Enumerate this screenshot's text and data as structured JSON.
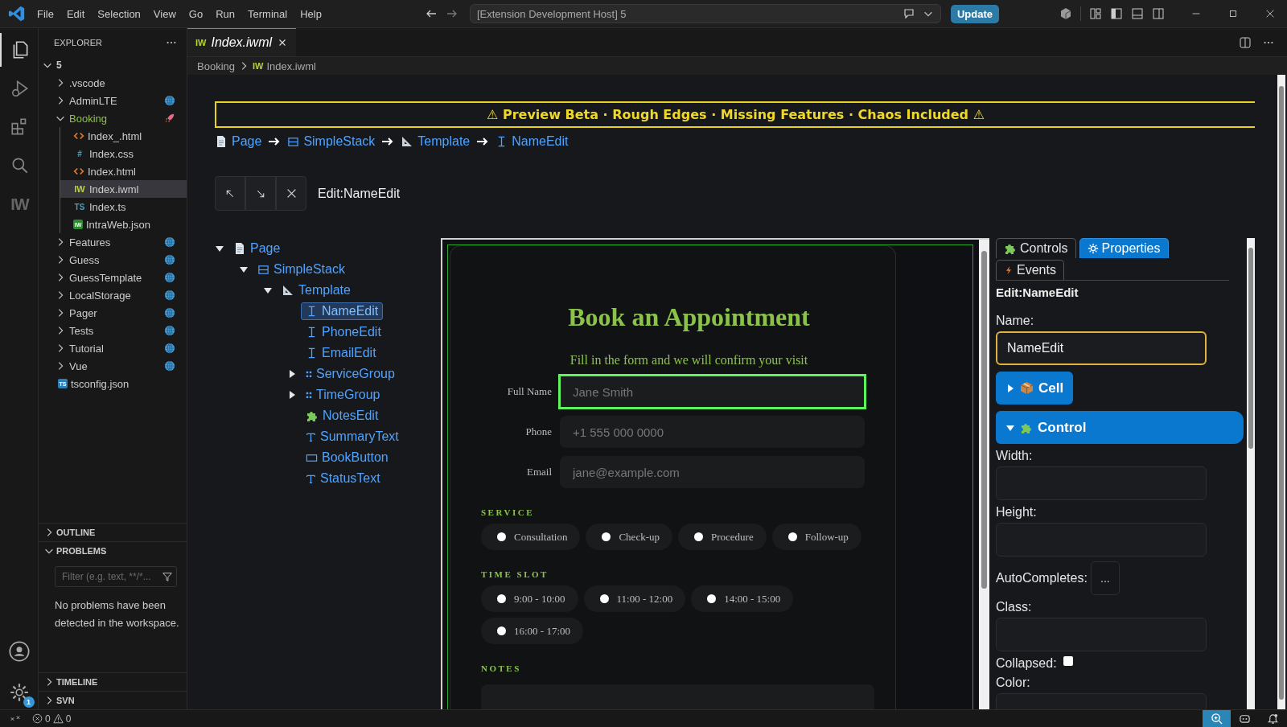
{
  "menu": [
    "File",
    "Edit",
    "Selection",
    "View",
    "Go",
    "Run",
    "Terminal",
    "Help"
  ],
  "command_center": "[Extension Development Host] 5",
  "update_button": "Update",
  "activity_bar": [
    {
      "kind": "files",
      "selected": true
    },
    {
      "kind": "run",
      "selected": false
    },
    {
      "kind": "extensions",
      "selected": false
    },
    {
      "kind": "search",
      "selected": false
    },
    {
      "kind": "iw",
      "label": "IW",
      "selected": false
    }
  ],
  "settings_badge": "1",
  "explorer": {
    "title": "EXPLORER",
    "root": "5",
    "items": [
      {
        "label": ".vscode",
        "kind": "folder",
        "expanded": false
      },
      {
        "label": "AdminLTE",
        "kind": "folder",
        "expanded": false,
        "decoration": {
          "kind": "globe"
        }
      },
      {
        "label": "Booking",
        "kind": "folder",
        "expanded": true,
        "decoration": {
          "kind": "rocket"
        },
        "color": "#8dc149",
        "children": [
          {
            "label": "Index_.html",
            "kind": "html",
            "selected": false
          },
          {
            "label": "Index.css",
            "kind": "css",
            "icon": "#",
            "selected": false
          },
          {
            "label": "Index.html",
            "kind": "html",
            "selected": false
          },
          {
            "label": "Index.iwml",
            "kind": "iwml",
            "icon": "IW",
            "selected": true
          },
          {
            "label": "Index.ts",
            "kind": "ts",
            "icon": "TS",
            "selected": false
          },
          {
            "label": "IntraWeb.json",
            "kind": "json",
            "icon": "IW",
            "selected": false
          }
        ]
      },
      {
        "label": "Features",
        "kind": "folder",
        "expanded": false,
        "decoration": {
          "kind": "globe"
        }
      },
      {
        "label": "Guess",
        "kind": "folder",
        "expanded": false,
        "decoration": {
          "kind": "globe"
        }
      },
      {
        "label": "GuessTemplate",
        "kind": "folder",
        "expanded": false,
        "decoration": {
          "kind": "globe"
        }
      },
      {
        "label": "LocalStorage",
        "kind": "folder",
        "expanded": false,
        "decoration": {
          "kind": "globe"
        }
      },
      {
        "label": "Pager",
        "kind": "folder",
        "expanded": false,
        "decoration": {
          "kind": "globe"
        }
      },
      {
        "label": "Tests",
        "kind": "folder",
        "expanded": false,
        "decoration": {
          "kind": "globe"
        }
      },
      {
        "label": "Tutorial",
        "kind": "folder",
        "expanded": false,
        "decoration": {
          "kind": "globe"
        }
      },
      {
        "label": "Vue",
        "kind": "folder",
        "expanded": false,
        "decoration": {
          "kind": "globe"
        }
      },
      {
        "label": "tsconfig.json",
        "kind": "tsconfig",
        "icon": "TS"
      }
    ]
  },
  "panels": [
    {
      "title": "OUTLINE",
      "expanded": false
    },
    {
      "title": "PROBLEMS",
      "expanded": true,
      "filter_placeholder": "Filter (e.g. text, **/*...",
      "message": "No problems have been detected in the workspace."
    },
    {
      "title": "TIMELINE",
      "expanded": false
    },
    {
      "title": "SVN",
      "expanded": false
    }
  ],
  "editor_tab": {
    "icon": "IW",
    "label": "Index.iwml"
  },
  "breadcrumb": {
    "folder": "Booking",
    "icon": "IW",
    "file": "Index.iwml"
  },
  "banner": "⚠ Preview Beta · Rough Edges · Missing Features · Chaos Included ⚠",
  "path": [
    {
      "kind": "page",
      "label": "Page"
    },
    {
      "kind": "stack",
      "label": "SimpleStack"
    },
    {
      "kind": "template",
      "label": "Template"
    },
    {
      "kind": "edit",
      "label": "NameEdit"
    }
  ],
  "toolbar": {
    "buttons": [
      {
        "kind": "up"
      },
      {
        "kind": "down"
      },
      {
        "kind": "close"
      }
    ],
    "label": "Edit:NameEdit"
  },
  "tree": [
    {
      "kind": "page",
      "label": "Page",
      "expanded": true,
      "selected": false,
      "children": [
        {
          "kind": "stack",
          "label": "SimpleStack",
          "expanded": true,
          "selected": false,
          "children": [
            {
              "kind": "template",
              "label": "Template",
              "expanded": true,
              "selected": false,
              "children": [
                {
                  "kind": "edit",
                  "label": "NameEdit",
                  "selected": true
                },
                {
                  "kind": "edit",
                  "label": "PhoneEdit",
                  "selected": false
                },
                {
                  "kind": "edit",
                  "label": "EmailEdit",
                  "selected": false
                },
                {
                  "kind": "group",
                  "label": "ServiceGroup",
                  "expanded": false,
                  "selected": false
                },
                {
                  "kind": "group",
                  "label": "TimeGroup",
                  "expanded": false,
                  "selected": false
                },
                {
                  "kind": "custom",
                  "label": "NotesEdit",
                  "selected": false
                },
                {
                  "kind": "text",
                  "label": "SummaryText",
                  "selected": false
                },
                {
                  "kind": "button",
                  "label": "BookButton",
                  "selected": false
                },
                {
                  "kind": "text",
                  "label": "StatusText",
                  "selected": false
                }
              ]
            }
          ]
        }
      ]
    }
  ],
  "preview": {
    "title": "Book an Appointment",
    "subtitle": "Fill in the form and we will confirm your visit",
    "fields": [
      {
        "label": "Full Name",
        "placeholder": "Jane Smith",
        "focused": true
      },
      {
        "label": "Phone",
        "placeholder": "+1 555 000 0000",
        "focused": false
      },
      {
        "label": "Email",
        "placeholder": "jane@example.com",
        "focused": false
      }
    ],
    "groups": [
      {
        "title": "SERVICE",
        "options": [
          {
            "label": "Consultation",
            "selected": false
          },
          {
            "label": "Check-up",
            "selected": false
          },
          {
            "label": "Procedure",
            "selected": false
          },
          {
            "label": "Follow-up",
            "selected": false
          }
        ]
      },
      {
        "title": "TIME SLOT",
        "options": [
          {
            "label": "9:00 - 10:00",
            "selected": false
          },
          {
            "label": "11:00 - 12:00",
            "selected": false
          },
          {
            "label": "14:00 - 15:00",
            "selected": false
          },
          {
            "label": "16:00 - 17:00",
            "selected": false
          }
        ]
      }
    ],
    "notes_title": "NOTES"
  },
  "inspector": {
    "tabs": [
      {
        "kind": "controls",
        "label": "Controls",
        "selected": false
      },
      {
        "kind": "properties",
        "label": "Properties",
        "selected": true
      },
      {
        "kind": "events",
        "label": "Events",
        "selected": false
      }
    ],
    "heading": "Edit:NameEdit",
    "name_label": "Name:",
    "name_value": "NameEdit",
    "sections": [
      {
        "kind": "cell",
        "label": "Cell",
        "expanded": false
      },
      {
        "kind": "control",
        "label": "Control",
        "expanded": true
      }
    ],
    "properties": [
      {
        "kind": "field",
        "label": "Width:"
      },
      {
        "kind": "field",
        "label": "Height:"
      },
      {
        "kind": "button",
        "label": "AutoCompletes:",
        "button": "..."
      },
      {
        "kind": "field",
        "label": "Class:"
      },
      {
        "kind": "checkbox",
        "label": "Collapsed:",
        "checked": false
      },
      {
        "kind": "field",
        "label": "Color:"
      }
    ]
  },
  "status_bar": {
    "errors": "0",
    "warnings": "0"
  }
}
